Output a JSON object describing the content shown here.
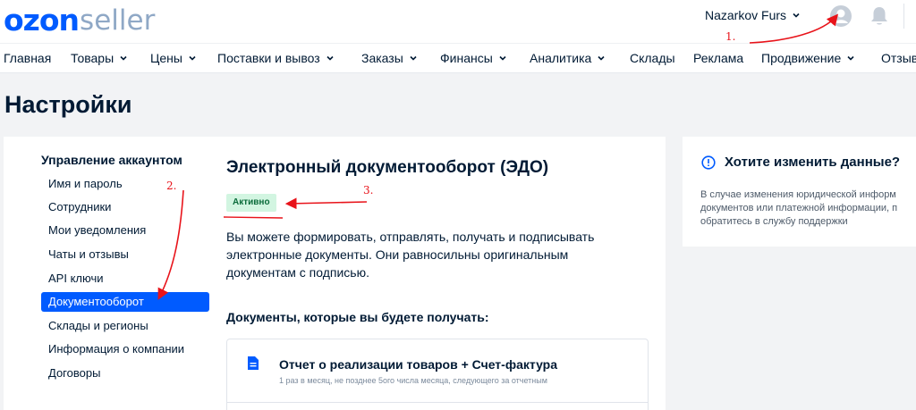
{
  "header": {
    "logo_ozon": "ozon",
    "logo_seller": "seller",
    "user_name": "Nazarkov Furs",
    "avatar_icon": "user-circle-icon",
    "bell_icon": "bell-icon"
  },
  "nav": {
    "items": [
      {
        "label": "Главная",
        "has_dropdown": false
      },
      {
        "label": "Товары",
        "has_dropdown": true
      },
      {
        "label": "Цены",
        "has_dropdown": true
      },
      {
        "label": "Поставки и вывоз",
        "has_dropdown": true
      },
      {
        "label": "Заказы",
        "has_dropdown": true
      },
      {
        "label": "Финансы",
        "has_dropdown": true
      },
      {
        "label": "Аналитика",
        "has_dropdown": true
      },
      {
        "label": "Склады",
        "has_dropdown": false
      },
      {
        "label": "Реклама",
        "has_dropdown": false
      },
      {
        "label": "Продвижение",
        "has_dropdown": true
      },
      {
        "label": "Отзыв",
        "has_dropdown": false
      }
    ]
  },
  "page": {
    "title": "Настройки"
  },
  "sidebar": {
    "heading": "Управление аккаунтом",
    "items": [
      {
        "label": "Имя и пароль",
        "active": false
      },
      {
        "label": "Сотрудники",
        "active": false
      },
      {
        "label": "Мои уведомления",
        "active": false
      },
      {
        "label": "Чаты и отзывы",
        "active": false
      },
      {
        "label": "API ключи",
        "active": false
      },
      {
        "label": "Документооборот",
        "active": true
      },
      {
        "label": "Склады и регионы",
        "active": false
      },
      {
        "label": "Информация о компании",
        "active": false
      },
      {
        "label": "Договоры",
        "active": false
      }
    ]
  },
  "main": {
    "title": "Электронный документооборот (ЭДО)",
    "status_badge": "Активно",
    "description_lines": [
      "Вы можете формировать, отправлять, получать и подписывать",
      "электронные документы. Они равносильны оригинальным",
      "документам с подписью."
    ],
    "docs_heading": "Документы, которые вы будете получать:",
    "documents": [
      {
        "icon": "document-icon",
        "title": "Отчет о реализации товаров + Счет-фактура",
        "subtitle": "1 раз в месяц, не позднее 5ого числа месяца, следующего за отчетным"
      }
    ]
  },
  "info_card": {
    "icon": "info-icon",
    "title": "Хотите изменить данные?",
    "text_lines": [
      "В случае изменения юридической информ",
      "документов или платежной информации, п",
      "обратитесь в службу поддержки"
    ]
  },
  "annotations": {
    "labels": [
      "1.",
      "2.",
      "3."
    ],
    "color": "#e8131a"
  },
  "colors": {
    "brand": "#005bff",
    "badge_bg": "#d2f5e1",
    "badge_text": "#0a6b3a"
  }
}
